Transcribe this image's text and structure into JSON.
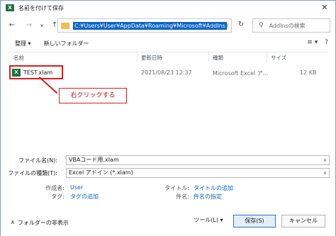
{
  "window": {
    "title": "名前を付けて保存",
    "title_icon": "X"
  },
  "nav": {
    "back": "←",
    "forward": "→",
    "dropdown": "∨",
    "up": "↑",
    "address": "C:¥Users¥User¥AppData¥Roaming¥Microsoft¥AddIns",
    "address_dropdown": "∨",
    "refresh": "↻",
    "search_icon": "⚲",
    "search_placeholder": "AddInsの検索"
  },
  "toolbar": {
    "organize": "整理 ▾",
    "new_folder": "新しいフォルダー",
    "view_icon": "≡ ▾",
    "help_icon": "?"
  },
  "columns": [
    "名前",
    "更新日時",
    "種類",
    "サイズ"
  ],
  "files": [
    {
      "name": "TEST.xlam",
      "modified": "2021/08/23 12:37",
      "type": "Microsoft Excel ア...",
      "size": "12 KB"
    }
  ],
  "annotation": {
    "label": "右クリックする"
  },
  "form": {
    "filename_label": "ファイル名(N):",
    "filename_value": "VBAコード用.xlam",
    "filetype_label": "ファイルの種類(T):",
    "filetype_value": "Excel アドイン (*.xlam)",
    "author_label": "作成者:",
    "author_value": "User",
    "tags_label": "タグ:",
    "tags_value": "タグの追加",
    "title_label": "タイトル:",
    "title_value": "タイトルの追加",
    "subject_label": "件名:",
    "subject_value": "件名の指定"
  },
  "footer": {
    "hide_folders_caret": "∧",
    "hide_folders": "フォルダーの非表示",
    "tools": "ツール(L) ▾",
    "save": "保存(S)",
    "cancel": "キャンセル"
  }
}
